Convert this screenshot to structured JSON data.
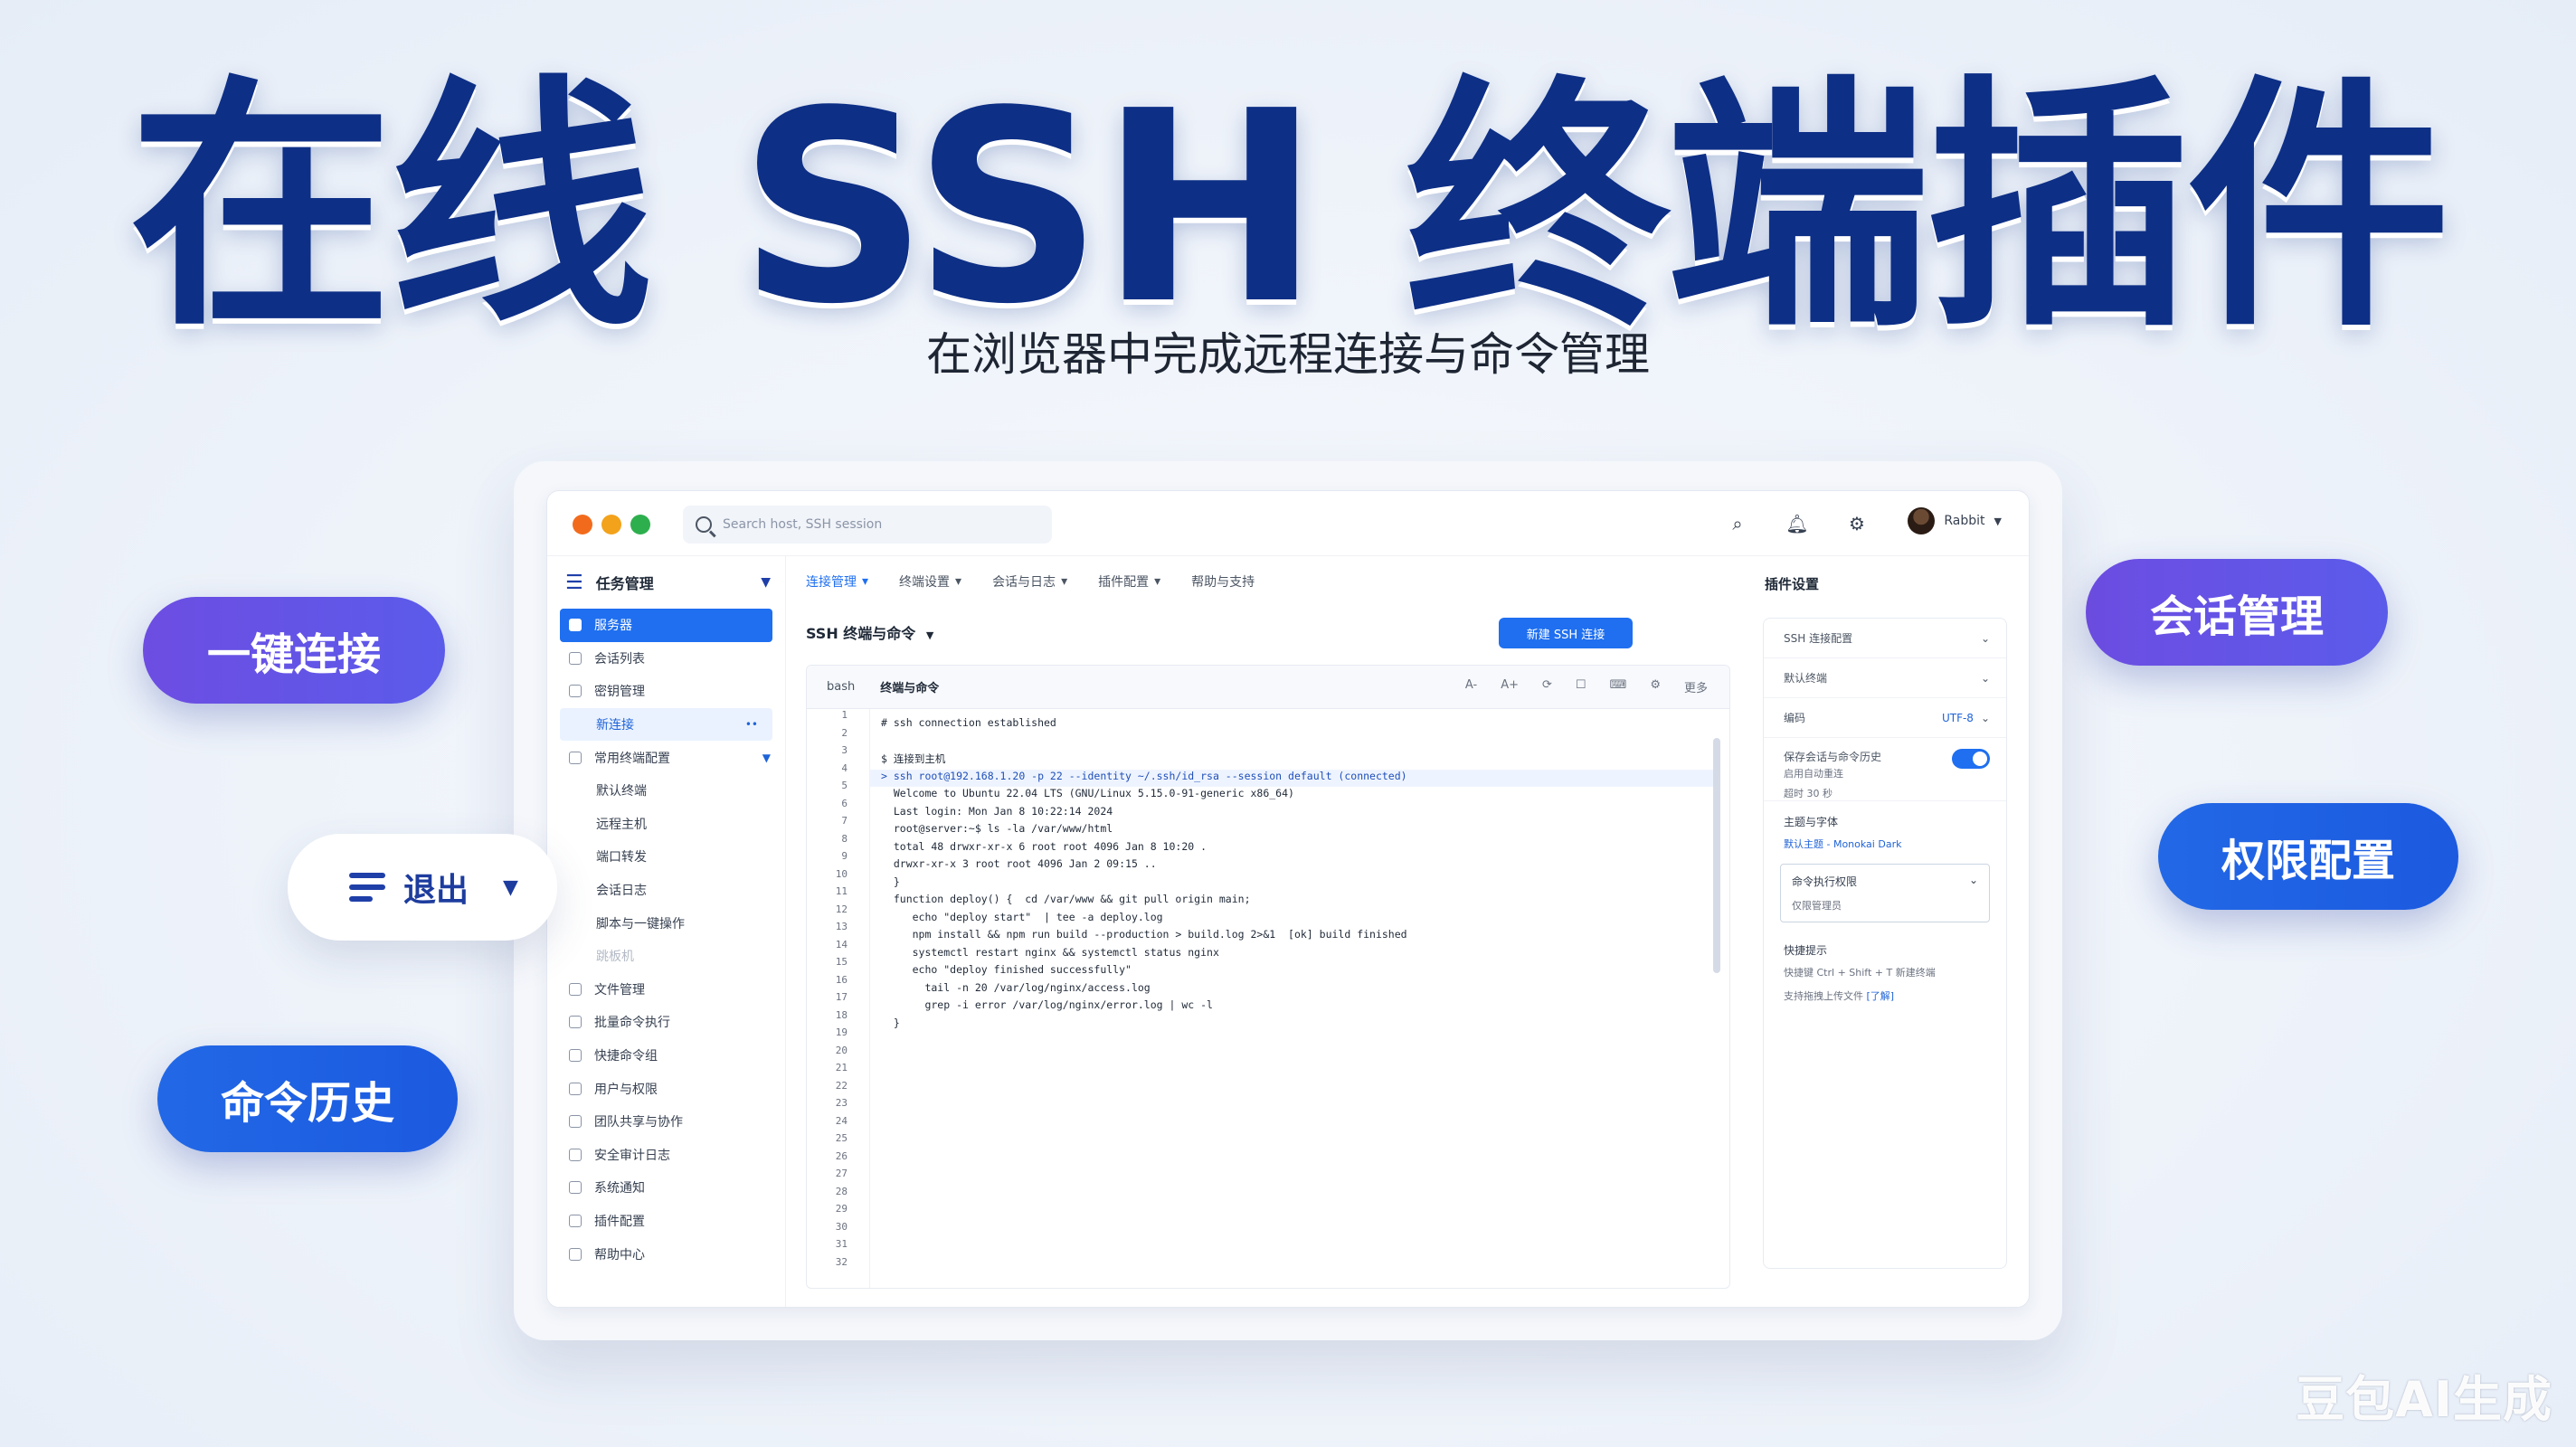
{
  "hero": {
    "title": "在线 SSH 终端插件",
    "subtitle": "在浏览器中完成远程连接与命令管理"
  },
  "badges": {
    "one_click": "一键连接",
    "history": "命令历史",
    "session": "会话管理",
    "permission": "权限配置"
  },
  "floating_select": {
    "label": "退出"
  },
  "colors": {
    "title": "#0d2f86",
    "purple_pill": "#6d4de2",
    "blue_pill": "#2268e6",
    "accent": "#1f6ff0"
  },
  "app": {
    "search_placeholder": "Search host, SSH session",
    "user_name": "Rabbit",
    "sidebar": {
      "header": "任务管理",
      "items": [
        {
          "label": "服务器",
          "state": "active"
        },
        {
          "label": "会话列表",
          "state": "normal"
        },
        {
          "label": "密钥管理",
          "state": "normal"
        },
        {
          "label": "新连接",
          "state": "highlight"
        },
        {
          "label": "常用终端配置",
          "state": "group"
        },
        {
          "label": "默认终端",
          "state": "sub"
        },
        {
          "label": "远程主机",
          "state": "sub"
        },
        {
          "label": "端口转发",
          "state": "sub"
        },
        {
          "label": "会话日志",
          "state": "sub"
        },
        {
          "label": "脚本与一键操作",
          "state": "sub"
        },
        {
          "label": "跳板机",
          "state": "dim"
        },
        {
          "label": "文件管理",
          "state": "normal"
        },
        {
          "label": "批量命令执行",
          "state": "normal"
        },
        {
          "label": "快捷命令组",
          "state": "normal"
        },
        {
          "label": "用户与权限",
          "state": "normal"
        },
        {
          "label": "团队共享与协作",
          "state": "normal"
        },
        {
          "label": "安全审计日志",
          "state": "normal"
        },
        {
          "label": "系统通知",
          "state": "normal"
        },
        {
          "label": "插件配置",
          "state": "normal"
        },
        {
          "label": "帮助中心",
          "state": "normal"
        }
      ]
    },
    "tabs": [
      "连接管理",
      "终端设置",
      "会话与日志",
      "插件配置",
      "帮助与支持"
    ],
    "section_title": "SSH 终端与命令",
    "primary_button": "新建 SSH 连接",
    "editor": {
      "toolbar_left": [
        "bash",
        "终端与命令"
      ],
      "toolbar_tools": [
        "A-",
        "A+",
        "⟳",
        "☐",
        "⌨",
        "⚙",
        "更多"
      ],
      "line_numbers": [
        "1",
        "2",
        "3",
        "4",
        "5",
        "6",
        "7",
        "8",
        "9",
        "10",
        "11",
        "12",
        "13",
        "14",
        "15",
        "16",
        "17",
        "18",
        "19",
        "20",
        "21",
        "22",
        "23",
        "24",
        "25",
        "26",
        "27",
        "28",
        "29",
        "30",
        "31",
        "32"
      ],
      "lines": [
        {
          "text": "# ssh connection established",
          "hl": false
        },
        {
          "text": "",
          "hl": false
        },
        {
          "text": "$ 连接到主机",
          "hl": false
        },
        {
          "text": "> ssh root@192.168.1.20 -p 22 --identity ~/.ssh/id_rsa --session default (connected)",
          "hl": true
        },
        {
          "text": "  Welcome to Ubuntu 22.04 LTS (GNU/Linux 5.15.0-91-generic x86_64)",
          "hl": false
        },
        {
          "text": "  Last login: Mon Jan 8 10:22:14 2024",
          "hl": false
        },
        {
          "text": "  root@server:~$ ls -la /var/www/html",
          "hl": false
        },
        {
          "text": "  total 48 drwxr-xr-x 6 root root 4096 Jan 8 10:20 .",
          "hl": false
        },
        {
          "text": "  drwxr-xr-x 3 root root 4096 Jan 2 09:15 ..",
          "hl": false
        },
        {
          "text": "  }",
          "hl": false
        },
        {
          "text": "  function deploy() {  cd /var/www && git pull origin main;",
          "hl": false
        },
        {
          "text": "     echo \"deploy start\"  | tee -a deploy.log",
          "hl": false
        },
        {
          "text": "     npm install && npm run build --production > build.log 2>&1  [ok] build finished",
          "hl": false
        },
        {
          "text": "     systemctl restart nginx && systemctl status nginx",
          "hl": false
        },
        {
          "text": "     echo \"deploy finished successfully\"",
          "hl": false
        },
        {
          "text": "       tail -n 20 /var/log/nginx/access.log",
          "hl": false
        },
        {
          "text": "       grep -i error /var/log/nginx/error.log | wc -l",
          "hl": false
        },
        {
          "text": "  }",
          "hl": false
        }
      ]
    },
    "panel": {
      "title": "插件设置",
      "select_top": "SSH 连接配置",
      "row1": "默认终端",
      "row2": "编码",
      "row2_value": "UTF-8",
      "toggle_label": "保存会话与命令历史",
      "toggle_sub1": "启用自动重连",
      "toggle_sub2": "超时 30 秒",
      "toggle_on": true,
      "group_label": "主题与字体",
      "group_value": "默认主题 - Monokai Dark",
      "select_box_title": "命令执行权限",
      "select_box_value": "仅限管理员",
      "tips_title": "快捷提示",
      "tip1": "快捷键 Ctrl + Shift + T 新建终端",
      "tip2": "支持拖拽上传文件",
      "tip2_link": "[了解]"
    }
  },
  "watermark": "豆包AI生成"
}
